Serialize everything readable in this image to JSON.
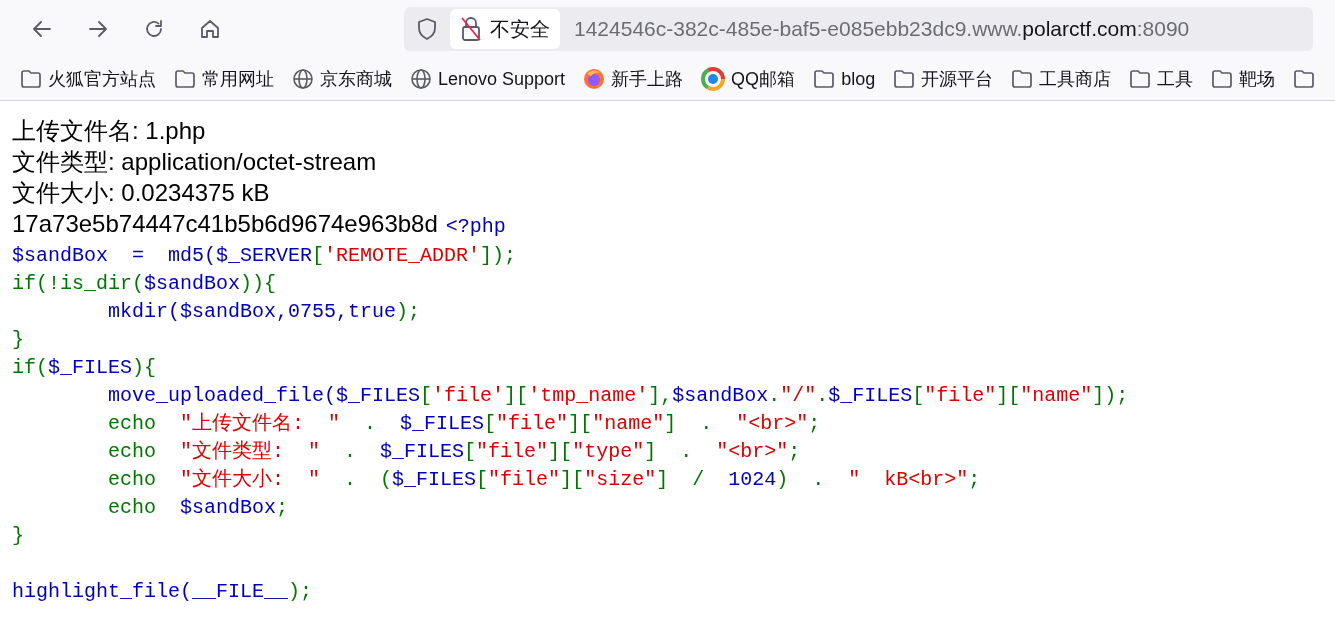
{
  "toolbar": {
    "security_label": "不安全",
    "url": [
      {
        "kind": "dim",
        "text": "1424546c-382c-485e-baf5-e085ebb23dc9.www."
      },
      {
        "kind": "host",
        "text": "polarctf.com"
      },
      {
        "kind": "dim",
        "text": ":8090"
      }
    ]
  },
  "bookmarks": [
    {
      "kind": "folder",
      "label": "火狐官方站点"
    },
    {
      "kind": "folder",
      "label": "常用网址"
    },
    {
      "kind": "site",
      "label": "京东商城"
    },
    {
      "kind": "site",
      "label": "Lenovo Support"
    },
    {
      "kind": "browser",
      "label": "新手上路"
    },
    {
      "kind": "mail",
      "label": "QQ邮箱"
    },
    {
      "kind": "folder",
      "label": "blog"
    },
    {
      "kind": "folder",
      "label": "开源平台"
    },
    {
      "kind": "folder",
      "label": "工具商店"
    },
    {
      "kind": "folder",
      "label": "工具"
    },
    {
      "kind": "folder",
      "label": "靶场"
    },
    {
      "kind": "folder"
    }
  ],
  "output_lines": [
    "上传文件名: 1.php",
    "文件类型: application/octet-stream",
    "文件大小: 0.0234375 kB",
    "17a73e5b74447c41b5b6d9674e963b8d"
  ],
  "code": {
    "blocks": [
      [
        {
          "segments": [
            {
              "kind": "default",
              "text": "<?php"
            }
          ]
        },
        {
          "segments": [
            {
              "kind": "default",
              "text": "$sandBox  =  md5($_SERVER"
            },
            {
              "kind": "keyword",
              "text": "["
            },
            {
              "kind": "string",
              "text": "'REMOTE_ADDR'"
            },
            {
              "kind": "keyword",
              "text": "]);"
            }
          ]
        },
        {
          "segments": [
            {
              "kind": "keyword",
              "text": "if(!is_dir("
            },
            {
              "kind": "default",
              "text": "$sandBox"
            },
            {
              "kind": "keyword",
              "text": ")){"
            }
          ]
        },
        {
          "segments": [
            {
              "kind": "default",
              "text": "        mkdir($sandBox,0755,true"
            },
            {
              "kind": "keyword",
              "text": ");"
            }
          ]
        },
        {
          "segments": [
            {
              "kind": "keyword",
              "text": "}"
            }
          ]
        },
        {
          "segments": [
            {
              "kind": "keyword",
              "text": "if("
            },
            {
              "kind": "default",
              "text": "$_FILES"
            },
            {
              "kind": "keyword",
              "text": "){"
            }
          ]
        },
        {
          "segments": [
            {
              "kind": "default",
              "text": "        move_uploaded_file($_FILES"
            },
            {
              "kind": "keyword",
              "text": "["
            },
            {
              "kind": "string",
              "text": "'file'"
            },
            {
              "kind": "keyword",
              "text": "]["
            },
            {
              "kind": "string",
              "text": "'tmp_name'"
            },
            {
              "kind": "keyword",
              "text": "],"
            },
            {
              "kind": "default",
              "text": "$sandBox"
            },
            {
              "kind": "keyword",
              "text": "."
            },
            {
              "kind": "string",
              "text": "\"/\""
            },
            {
              "kind": "keyword",
              "text": "."
            },
            {
              "kind": "default",
              "text": "$_FILES"
            },
            {
              "kind": "keyword",
              "text": "["
            },
            {
              "kind": "string",
              "text": "\"file\""
            },
            {
              "kind": "keyword",
              "text": "]["
            },
            {
              "kind": "string",
              "text": "\"name\""
            },
            {
              "kind": "keyword",
              "text": "]);"
            }
          ]
        },
        {
          "segments": [
            {
              "kind": "keyword",
              "text": "        echo  "
            },
            {
              "kind": "string",
              "text": "\"上传文件名:  \""
            },
            {
              "kind": "keyword",
              "text": "  .  "
            },
            {
              "kind": "default",
              "text": "$_FILES"
            },
            {
              "kind": "keyword",
              "text": "["
            },
            {
              "kind": "string",
              "text": "\"file\""
            },
            {
              "kind": "keyword",
              "text": "]["
            },
            {
              "kind": "string",
              "text": "\"name\""
            },
            {
              "kind": "keyword",
              "text": "]  .  "
            },
            {
              "kind": "string",
              "text": "\"<br>\""
            },
            {
              "kind": "keyword",
              "text": ";"
            }
          ]
        },
        {
          "segments": [
            {
              "kind": "keyword",
              "text": "        echo  "
            },
            {
              "kind": "string",
              "text": "\"文件类型:  \""
            },
            {
              "kind": "keyword",
              "text": "  .  "
            },
            {
              "kind": "default",
              "text": "$_FILES"
            },
            {
              "kind": "keyword",
              "text": "["
            },
            {
              "kind": "string",
              "text": "\"file\""
            },
            {
              "kind": "keyword",
              "text": "]["
            },
            {
              "kind": "string",
              "text": "\"type\""
            },
            {
              "kind": "keyword",
              "text": "]  .  "
            },
            {
              "kind": "string",
              "text": "\"<br>\""
            },
            {
              "kind": "keyword",
              "text": ";"
            }
          ]
        },
        {
          "segments": [
            {
              "kind": "keyword",
              "text": "        echo  "
            },
            {
              "kind": "string",
              "text": "\"文件大小:  \""
            },
            {
              "kind": "keyword",
              "text": "  .  ("
            },
            {
              "kind": "default",
              "text": "$_FILES"
            },
            {
              "kind": "keyword",
              "text": "["
            },
            {
              "kind": "string",
              "text": "\"file\""
            },
            {
              "kind": "keyword",
              "text": "]["
            },
            {
              "kind": "string",
              "text": "\"size\""
            },
            {
              "kind": "keyword",
              "text": "]  /  "
            },
            {
              "kind": "default",
              "text": "1024"
            },
            {
              "kind": "keyword",
              "text": ")  .  "
            },
            {
              "kind": "string",
              "text": "\"  kB<br>\""
            },
            {
              "kind": "keyword",
              "text": ";"
            }
          ]
        },
        {
          "segments": [
            {
              "kind": "keyword",
              "text": "        echo  "
            },
            {
              "kind": "default",
              "text": "$sandBox"
            },
            {
              "kind": "keyword",
              "text": ";"
            }
          ]
        },
        {
          "segments": [
            {
              "kind": "keyword",
              "text": "}"
            }
          ]
        }
      ],
      [
        {
          "segments": [
            {
              "kind": "default",
              "text": "highlight_file(__FILE__"
            },
            {
              "kind": "keyword",
              "text": ");"
            }
          ]
        }
      ]
    ]
  }
}
